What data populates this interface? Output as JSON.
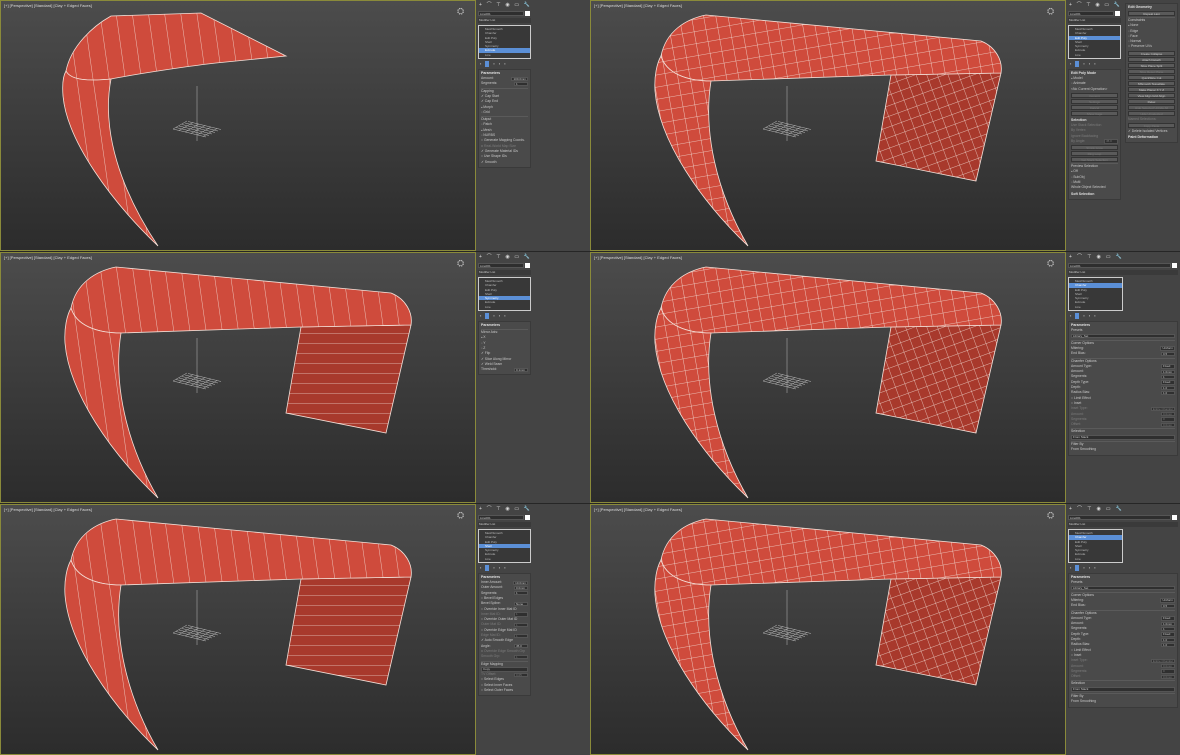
{
  "viewport_label": "[+] [Perspective] [Standard] [Clay + Edged Faces]",
  "object_name": "Line001",
  "modifier_list": "Modifier List",
  "colors": {
    "mesh": "#cf4b3c",
    "mesh_dark": "#a8392c",
    "selected": "#5b8fd6",
    "active_border": "#8a8a3a"
  },
  "icons": [
    "plus-icon",
    "curve-icon",
    "hierarchy-icon",
    "motion-icon",
    "display-icon",
    "utilities-icon"
  ],
  "panels": [
    {
      "stack": [
        "MeshSmooth",
        "Chamfer",
        "Edit Poly",
        "Shell",
        "Symmetry",
        "Extrude",
        "Line"
      ],
      "selected": 5,
      "columns": [
        [
          {
            "t": "header",
            "text": "Parameters"
          },
          {
            "t": "field",
            "label": "Amount:",
            "value": "100.0mm"
          },
          {
            "t": "field",
            "label": "Segments:",
            "value": "1"
          },
          {
            "t": "group",
            "text": "Capping"
          },
          {
            "t": "check",
            "text": "Cap Start",
            "on": true
          },
          {
            "t": "check",
            "text": "Cap End",
            "on": true
          },
          {
            "t": "radio",
            "text": "Morph",
            "on": true
          },
          {
            "t": "radio",
            "text": "Grid",
            "on": false
          },
          {
            "t": "group",
            "text": "Output"
          },
          {
            "t": "radio",
            "text": "Patch",
            "on": false
          },
          {
            "t": "radio",
            "text": "Mesh",
            "on": true
          },
          {
            "t": "radio",
            "text": "NURBS",
            "on": false
          },
          {
            "t": "check",
            "text": "Generate Mapping Coords.",
            "on": false
          },
          {
            "t": "check",
            "text": "Real-World Map Size",
            "on": false,
            "dim": true
          },
          {
            "t": "check",
            "text": "Generate Material IDs",
            "on": true
          },
          {
            "t": "check",
            "text": "Use Shape IDs",
            "on": false
          },
          {
            "t": "check",
            "text": "Smooth",
            "on": true
          }
        ]
      ]
    },
    {
      "stack": [
        "MeshSmooth",
        "Chamfer",
        "Edit Poly",
        "Shell",
        "Symmetry",
        "Extrude",
        "Line"
      ],
      "selected": 2,
      "columns": [
        [
          {
            "t": "header",
            "text": "Edit Poly Mode"
          },
          {
            "t": "radio",
            "text": "Model",
            "on": true
          },
          {
            "t": "radio",
            "text": "Animate",
            "on": false
          },
          {
            "t": "label",
            "text": "<No Current Operation>"
          },
          {
            "t": "button",
            "text": "Commit",
            "dim": true
          },
          {
            "t": "button",
            "text": "Settings",
            "dim": true
          },
          {
            "t": "button",
            "text": "Cancel",
            "dim": true
          },
          {
            "t": "button",
            "text": "Show Cage",
            "dim": true
          },
          {
            "t": "header",
            "text": "Selection"
          },
          {
            "t": "label",
            "text": "Use Stack Selection",
            "dim": true
          },
          {
            "t": "label",
            "text": "By Vertex",
            "dim": true
          },
          {
            "t": "label",
            "text": "Ignore Backfacing",
            "dim": true
          },
          {
            "t": "field",
            "label": "By Angle:",
            "value": "45.0",
            "dim": true
          },
          {
            "t": "button",
            "text": "Shrink   Grow",
            "dim": true
          },
          {
            "t": "button",
            "text": "Ring   Loop",
            "dim": true
          },
          {
            "t": "button",
            "text": "Get Stack Selection",
            "dim": true
          },
          {
            "t": "group",
            "text": "Preview Selection"
          },
          {
            "t": "radio",
            "text": "Off",
            "on": true
          },
          {
            "t": "radio",
            "text": "SubObj",
            "on": false
          },
          {
            "t": "radio",
            "text": "Multi",
            "on": false
          },
          {
            "t": "label",
            "text": "Whole Object Selected"
          },
          {
            "t": "header",
            "text": "Soft Selection"
          }
        ],
        [
          {
            "t": "header",
            "text": "Edit Geometry"
          },
          {
            "t": "button",
            "text": "Repeat Last"
          },
          {
            "t": "group",
            "text": "Constraints"
          },
          {
            "t": "radio",
            "text": "None",
            "on": true
          },
          {
            "t": "radio",
            "text": "Edge",
            "on": false
          },
          {
            "t": "radio",
            "text": "Face",
            "on": false
          },
          {
            "t": "radio",
            "text": "Normal",
            "on": false
          },
          {
            "t": "check",
            "text": "Preserve UVs",
            "on": false
          },
          {
            "t": "button",
            "text": "Create   Collapse"
          },
          {
            "t": "button",
            "text": "Attach   Detach"
          },
          {
            "t": "button",
            "text": "Slice Plane   Split"
          },
          {
            "t": "button",
            "text": "Slice   Reset Plane",
            "dim": true
          },
          {
            "t": "button",
            "text": "QuickSlice   Cut"
          },
          {
            "t": "button",
            "text": "MSmooth   Tessellate"
          },
          {
            "t": "button",
            "text": "Make Planar  X Y Z"
          },
          {
            "t": "button",
            "text": "View Align   Grid Align"
          },
          {
            "t": "button",
            "text": "Relax"
          },
          {
            "t": "button",
            "text": "Hide Selected   Unhide All",
            "dim": true
          },
          {
            "t": "button",
            "text": "Hide Unselected",
            "dim": true
          },
          {
            "t": "label",
            "text": "Named Selections:",
            "dim": true
          },
          {
            "t": "button",
            "text": "Copy   Paste",
            "dim": true
          },
          {
            "t": "check",
            "text": "Delete Isolated Vertices",
            "on": true
          },
          {
            "t": "header",
            "text": "Paint Deformation"
          }
        ]
      ]
    },
    {
      "stack": [
        "MeshSmooth",
        "Chamfer",
        "Edit Poly",
        "Shell",
        "Symmetry",
        "Extrude",
        "Line"
      ],
      "selected": 4,
      "columns": [
        [
          {
            "t": "header",
            "text": "Parameters"
          },
          {
            "t": "group",
            "text": "Mirror Axis:"
          },
          {
            "t": "radio",
            "text": "X",
            "on": true
          },
          {
            "t": "radio",
            "text": "Y",
            "on": false
          },
          {
            "t": "radio",
            "text": "Z",
            "on": false
          },
          {
            "t": "check",
            "text": "Flip",
            "on": true
          },
          {
            "t": "check",
            "text": "Slice Along Mirror",
            "on": true
          },
          {
            "t": "check",
            "text": "Weld Seam",
            "on": true
          },
          {
            "t": "field",
            "label": "Threshold:",
            "value": "0.1mm"
          }
        ]
      ]
    },
    {
      "stack": [
        "MeshSmooth",
        "Chamfer",
        "Edit Poly",
        "Shell",
        "Symmetry",
        "Extrude",
        "Line"
      ],
      "selected": 1,
      "wide": true,
      "columns": [
        [
          {
            "t": "header",
            "text": "Parameters"
          },
          {
            "t": "label",
            "text": "Presets"
          },
          {
            "t": "dropdown",
            "value": "Library_Set"
          },
          {
            "t": "group",
            "text": "Corner Options"
          },
          {
            "t": "field",
            "label": "Mitering:",
            "value": "Uniform"
          },
          {
            "t": "field",
            "label": "End Bias:",
            "value": "0.5"
          },
          {
            "t": "group",
            "text": "Chamfer Options"
          },
          {
            "t": "field",
            "label": "Amount Type:",
            "value": "Fixed"
          },
          {
            "t": "field",
            "label": "Amount:",
            "value": "1.0mm"
          },
          {
            "t": "field",
            "label": "Segments:",
            "value": "1"
          },
          {
            "t": "field",
            "label": "Depth Type:",
            "value": "Fixed"
          },
          {
            "t": "field",
            "label": "Depth:",
            "value": "1.0"
          },
          {
            "t": "field",
            "label": "Radius Bias:",
            "value": "1.0"
          },
          {
            "t": "check",
            "text": "Limit Effect",
            "on": false
          },
          {
            "t": "check",
            "text": "Inset",
            "on": false
          },
          {
            "t": "field",
            "label": "Inset Type:",
            "value": "Entire Chamfer",
            "dim": true
          },
          {
            "t": "field",
            "label": "Amount:",
            "value": "0.0mm",
            "dim": true
          },
          {
            "t": "field",
            "label": "Segments:",
            "value": "0",
            "dim": true
          },
          {
            "t": "field",
            "label": "Offset:",
            "value": "0.0mm",
            "dim": true
          },
          {
            "t": "group",
            "text": "Selection"
          },
          {
            "t": "dropdown",
            "value": "From Stack"
          },
          {
            "t": "group",
            "text": "Filter By"
          },
          {
            "t": "label",
            "text": "From Smoothing"
          }
        ]
      ]
    },
    {
      "stack": [
        "MeshSmooth",
        "Chamfer",
        "Edit Poly",
        "Shell",
        "Symmetry",
        "Extrude",
        "Line"
      ],
      "selected": 3,
      "columns": [
        [
          {
            "t": "header",
            "text": "Parameters"
          },
          {
            "t": "field",
            "label": "Inner Amount:",
            "value": "10.0mm"
          },
          {
            "t": "field",
            "label": "Outer Amount:",
            "value": "0.0mm"
          },
          {
            "t": "field",
            "label": "Segments:",
            "value": "1"
          },
          {
            "t": "check",
            "text": "Bevel Edges",
            "on": false
          },
          {
            "t": "field",
            "label": "Bevel Spline:",
            "value": "None"
          },
          {
            "t": "check",
            "text": "Override Inner Mat ID",
            "on": false
          },
          {
            "t": "field",
            "label": "Inner Mat ID:",
            "value": "1",
            "dim": true
          },
          {
            "t": "check",
            "text": "Override Outer Mat ID",
            "on": false
          },
          {
            "t": "field",
            "label": "Outer Mat ID:",
            "value": "1",
            "dim": true
          },
          {
            "t": "check",
            "text": "Override Edge Mat ID",
            "on": false
          },
          {
            "t": "field",
            "label": "Edge Mat ID:",
            "value": "1",
            "dim": true
          },
          {
            "t": "check",
            "text": "Auto Smooth Edge",
            "on": true
          },
          {
            "t": "field",
            "label": "Angle:",
            "value": "45.0"
          },
          {
            "t": "check",
            "text": "Override Edge Smooth Grp",
            "on": false,
            "dim": true
          },
          {
            "t": "field",
            "label": "Smooth Grp:",
            "value": "1",
            "dim": true
          },
          {
            "t": "group",
            "text": "Edge Mapping"
          },
          {
            "t": "dropdown",
            "value": "Copy"
          },
          {
            "t": "field",
            "label": "TV Offset:",
            "value": "0.05",
            "dim": true
          },
          {
            "t": "check",
            "text": "Select Edges",
            "on": false
          },
          {
            "t": "check",
            "text": "Select Inner Faces",
            "on": false
          },
          {
            "t": "check",
            "text": "Select Outer Faces",
            "on": false
          }
        ]
      ]
    },
    {
      "stack": [
        "MeshSmooth",
        "Chamfer",
        "Edit Poly",
        "Shell",
        "Symmetry",
        "Extrude",
        "Line"
      ],
      "selected": 1,
      "wide": true,
      "columns": [
        [
          {
            "t": "header",
            "text": "Parameters"
          },
          {
            "t": "label",
            "text": "Presets"
          },
          {
            "t": "dropdown",
            "value": "Library_Set"
          },
          {
            "t": "group",
            "text": "Corner Options"
          },
          {
            "t": "field",
            "label": "Mitering:",
            "value": "Uniform"
          },
          {
            "t": "field",
            "label": "End Bias:",
            "value": "0.5"
          },
          {
            "t": "group",
            "text": "Chamfer Options"
          },
          {
            "t": "field",
            "label": "Amount Type:",
            "value": "Fixed"
          },
          {
            "t": "field",
            "label": "Amount:",
            "value": "1.0mm"
          },
          {
            "t": "field",
            "label": "Segments:",
            "value": "1"
          },
          {
            "t": "field",
            "label": "Depth Type:",
            "value": "Fixed"
          },
          {
            "t": "field",
            "label": "Depth:",
            "value": "1.0"
          },
          {
            "t": "field",
            "label": "Radius Bias:",
            "value": "1.0"
          },
          {
            "t": "check",
            "text": "Limit Effect",
            "on": false
          },
          {
            "t": "check",
            "text": "Inset",
            "on": false
          },
          {
            "t": "field",
            "label": "Inset Type:",
            "value": "Entire Chamfer",
            "dim": true
          },
          {
            "t": "field",
            "label": "Amount:",
            "value": "0.0mm",
            "dim": true
          },
          {
            "t": "field",
            "label": "Segments:",
            "value": "0",
            "dim": true
          },
          {
            "t": "field",
            "label": "Offset:",
            "value": "0.0mm",
            "dim": true
          },
          {
            "t": "group",
            "text": "Selection"
          },
          {
            "t": "dropdown",
            "value": "From Stack"
          },
          {
            "t": "group",
            "text": "Filter By"
          },
          {
            "t": "label",
            "text": "From Smoothing"
          }
        ]
      ]
    }
  ]
}
